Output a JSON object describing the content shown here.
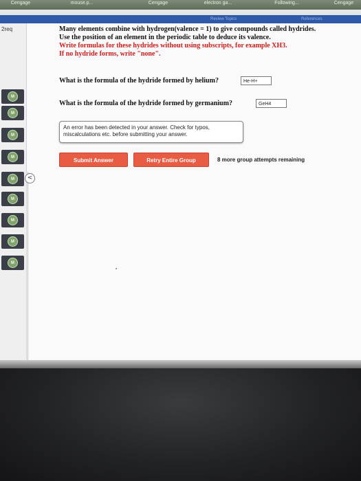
{
  "browser_tabs": [
    "Cengage",
    "mouse.p...",
    "Cengage",
    "electron ga...",
    "Following...",
    "Cengage"
  ],
  "header_tabs": [
    "Review Topics",
    "References"
  ],
  "sidebar": {
    "label": "2req",
    "items": [
      "M",
      "M",
      "M",
      "M",
      "M",
      "M",
      "M",
      "M",
      "M"
    ],
    "collapse_glyph": "<"
  },
  "instructions": {
    "line1": "Many elements combine with hydrogen(valence = 1) to give compounds called hydrides.",
    "line2": "Use the position of an element in the periodic table to deduce its valence.",
    "line3_prefix": "Write formulas for these hydrides ",
    "line3_bold": "without using subscripts, for example XH3.",
    "line4": "If no hydride forms, write \"none\"."
  },
  "questions": [
    {
      "prefix": "What is the formula of the hydride formed by ",
      "element": "helium",
      "suffix": "?",
      "answer": "He-H+"
    },
    {
      "prefix": "What is the formula of the hydride formed by ",
      "element": "germanium",
      "suffix": "?",
      "answer": "GeH4"
    }
  ],
  "error_message": "An error has been detected in your answer. Check for typos, miscalculations etc. before submitting your answer.",
  "buttons": {
    "submit": "Submit Answer",
    "retry": "Retry Entire Group"
  },
  "attempts_text": "8 more group attempts remaining",
  "colors": {
    "button_red": "#e85c44",
    "header_blue": "#2e59a8",
    "instruction_red": "#d11a1a",
    "badge_green": "#7fa36b"
  }
}
